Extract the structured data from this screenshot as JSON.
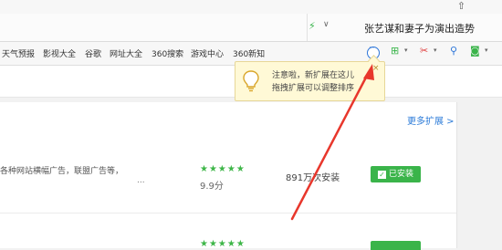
{
  "window": {
    "pin_icon": "pin-icon"
  },
  "addressbar": {
    "hot_search": "张艺谋和妻子为演出造势"
  },
  "bookmarks": [
    "天气预报",
    "影视大全",
    "谷歌",
    "网址大全",
    "360搜索",
    "游戏中心",
    "360新知"
  ],
  "toolbar": {
    "icons": [
      "extension-manager-icon",
      "cloud-plus-icon",
      "scissors-icon",
      "search-icon",
      "gamepad-icon"
    ]
  },
  "tooltip": {
    "line1": "注意啦，新扩展在这儿",
    "line2": "拖拽扩展可以调整排序",
    "close": "×"
  },
  "content": {
    "more_link": "更多扩展 >",
    "item": {
      "desc": "各种网站横幅广告，联盟广告等，",
      "dots": "...",
      "stars": "★★★★★",
      "rating": "9.9分",
      "installs": "891万次安装",
      "status": "已安装"
    },
    "next_stars": "★★★★★"
  },
  "colors": {
    "accent_green": "#3ab44a",
    "link_blue": "#2a7ad8",
    "arrow_red": "#e8372c",
    "tooltip_bg": "#fff9d6"
  }
}
